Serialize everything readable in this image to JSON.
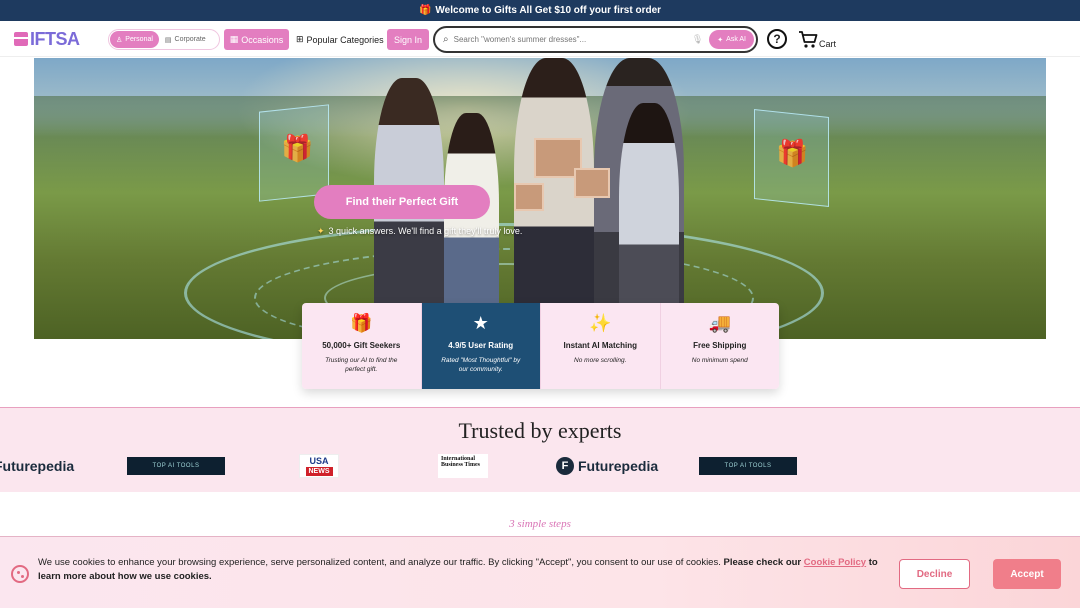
{
  "topbar": {
    "icon": "gift-icon",
    "text": "Welcome to Gifts All Get $10 off your first order"
  },
  "header": {
    "logo": "IFTSA",
    "segments": [
      {
        "label": "Personal",
        "active": true
      },
      {
        "label": "Corporate",
        "active": false
      }
    ],
    "occasions_label": "Occasions",
    "popular_label": "Popular Categories",
    "signin_label": "Sign In",
    "search": {
      "placeholder": "Search \"women's summer dresses\"...",
      "askai_label": "Ask AI"
    },
    "help_label": "?",
    "cart_label": "Cart"
  },
  "hero": {
    "cta_label": "Find their Perfect Gift",
    "cta_sub": "3 quick answers. We'll find a gift they'll truly love."
  },
  "features": [
    {
      "icon": "gift-box-icon",
      "title": "50,000+ Gift Seekers",
      "desc": "Trusting our AI to find the perfect gift.",
      "active": false
    },
    {
      "icon": "star-icon",
      "title": "4.9/5 User Rating",
      "desc": "Rated \"Most Thoughtful\" by our community.",
      "active": true
    },
    {
      "icon": "ai-sparkle-icon",
      "title": "Instant AI Matching",
      "desc": "No more scrolling.",
      "active": false
    },
    {
      "icon": "truck-icon",
      "title": "Free Shipping",
      "desc": "No minimum spend",
      "active": false
    }
  ],
  "trusted": {
    "title": "Trusted by experts",
    "logos": {
      "futurepedia": "Futurepedia",
      "topai": "TOP AI TOOLS",
      "usa_top": "USA",
      "usa_bottom": "NEWS",
      "ibt": "International Business Times"
    }
  },
  "steps_label": "3 simple steps",
  "cookie": {
    "text": "We use cookies to enhance your browsing experience, serve personalized content, and analyze our traffic. By clicking \"Accept\", you consent to our use of cookies. ",
    "bold1": "Please check our ",
    "link": "Cookie Policy",
    "bold2": " to learn more about how we use cookies.",
    "decline_label": "Decline",
    "accept_label": "Accept"
  },
  "colors": {
    "brand_pink": "#e37ec0",
    "navy": "#1e3a5f",
    "active_card": "#1e4f75",
    "cookie_accent": "#e26a82"
  }
}
